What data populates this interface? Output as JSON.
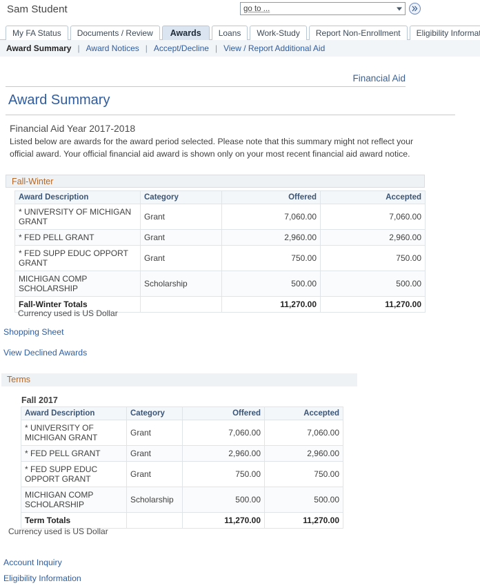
{
  "header": {
    "user_name": "Sam Student",
    "goto": {
      "selected": "go to ...",
      "dropdown_icon": "chevron-down-icon",
      "go_button_icon": "double-chevron-right-icon"
    }
  },
  "tabs": [
    {
      "label": "My FA Status",
      "active": false
    },
    {
      "label": "Documents / Review",
      "active": false
    },
    {
      "label": "Awards",
      "active": true
    },
    {
      "label": "Loans",
      "active": false
    },
    {
      "label": "Work-Study",
      "active": false
    },
    {
      "label": "Report Non-Enrollment",
      "active": false
    },
    {
      "label": "Eligibility Information",
      "active": false
    }
  ],
  "subnav": {
    "separator": "|",
    "items": [
      {
        "label": "Award Summary",
        "active": true
      },
      {
        "label": "Award Notices",
        "active": false
      },
      {
        "label": "Accept/Decline",
        "active": false
      },
      {
        "label": "View / Report Additional Aid",
        "active": false
      }
    ]
  },
  "breadcrumb": "Financial Aid",
  "page_title": "Award Summary",
  "intro": {
    "aid_year": "Financial Aid Year 2017-2018",
    "description": "Listed below are awards for the award period selected. Please note that this summary might not reflect your official award. Your official financial aid award is shown only on your most recent financial aid award notice."
  },
  "fall_winter": {
    "group_label": "Fall-Winter",
    "columns": [
      "Award Description",
      "Category",
      "Offered",
      "Accepted"
    ],
    "rows": [
      {
        "description": "* UNIVERSITY OF MICHIGAN GRANT",
        "category": "Grant",
        "offered": "7,060.00",
        "accepted": "7,060.00"
      },
      {
        "description": "* FED PELL GRANT",
        "category": "Grant",
        "offered": "2,960.00",
        "accepted": "2,960.00"
      },
      {
        "description": "* FED SUPP EDUC OPPORT GRANT",
        "category": "Grant",
        "offered": "750.00",
        "accepted": "750.00"
      },
      {
        "description": "MICHIGAN COMP SCHOLARSHIP",
        "category": "Scholarship",
        "offered": "500.00",
        "accepted": "500.00"
      }
    ],
    "totals": {
      "description": "Fall-Winter Totals",
      "category": "",
      "offered": "11,270.00",
      "accepted": "11,270.00"
    },
    "currency_note": "Currency used is US Dollar",
    "links": [
      "Shopping Sheet",
      "View Declined Awards"
    ]
  },
  "terms": {
    "group_label": "Terms",
    "term_label": "Fall 2017",
    "columns": [
      "Award Description",
      "Category",
      "Offered",
      "Accepted"
    ],
    "rows": [
      {
        "description": "* UNIVERSITY OF MICHIGAN GRANT",
        "category": "Grant",
        "offered": "7,060.00",
        "accepted": "7,060.00"
      },
      {
        "description": "* FED PELL GRANT",
        "category": "Grant",
        "offered": "2,960.00",
        "accepted": "2,960.00"
      },
      {
        "description": "* FED SUPP EDUC OPPORT GRANT",
        "category": "Grant",
        "offered": "750.00",
        "accepted": "750.00"
      },
      {
        "description": "MICHIGAN COMP SCHOLARSHIP",
        "category": "Scholarship",
        "offered": "500.00",
        "accepted": "500.00"
      }
    ],
    "totals": {
      "description": "Term Totals",
      "category": "",
      "offered": "11,270.00",
      "accepted": "11,270.00"
    },
    "currency_note": "Currency used is US Dollar"
  },
  "footer_links": [
    "Account Inquiry",
    "Eligibility Information"
  ],
  "colors": {
    "link": "#2f5c9e",
    "group_header_text": "#b3682a",
    "group_header_bg": "#eef2f5",
    "active_tab_bg": "#dbe5f1",
    "table_header_bg": "#f4f7f9",
    "table_border": "#dfe4e9"
  }
}
